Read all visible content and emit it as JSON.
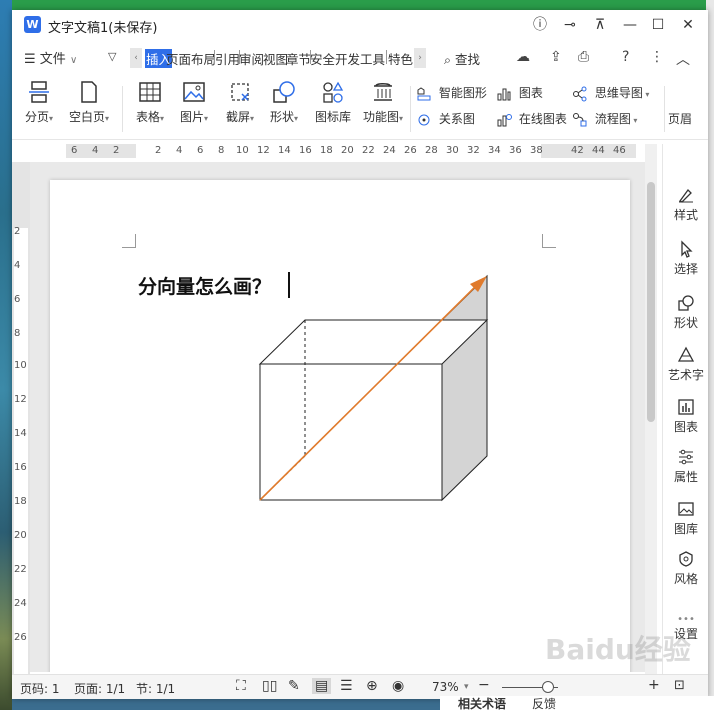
{
  "window": {
    "title": "文字文稿1(未保存)",
    "logo": "W"
  },
  "tabs": {
    "menu_label": "文件",
    "items": [
      "插入",
      "页面布局",
      "引用",
      "审阅",
      "视图",
      "章节",
      "安全",
      "开发工具",
      "特色"
    ],
    "active": "插入",
    "search_label": "查找"
  },
  "toolbar": {
    "large": [
      {
        "label": "分页",
        "icon": "page-break-icon"
      },
      {
        "label": "空白页",
        "icon": "blank-page-icon"
      },
      {
        "label": "表格",
        "icon": "table-icon"
      },
      {
        "label": "图片",
        "icon": "picture-icon"
      },
      {
        "label": "截屏",
        "icon": "screenshot-icon"
      },
      {
        "label": "形状",
        "icon": "shapes-icon"
      },
      {
        "label": "图标库",
        "icon": "icon-library-icon"
      },
      {
        "label": "功能图",
        "icon": "function-chart-icon"
      }
    ],
    "small": [
      {
        "label": "智能图形",
        "icon": "smart-art-icon"
      },
      {
        "label": "图表",
        "icon": "chart-icon"
      },
      {
        "label": "思维导图",
        "icon": "mind-map-icon"
      },
      {
        "label": "关系图",
        "icon": "relation-diagram-icon"
      },
      {
        "label": "在线图表",
        "icon": "online-chart-icon"
      },
      {
        "label": "流程图",
        "icon": "flowchart-icon"
      }
    ],
    "overflow_label": "页眉"
  },
  "ruler": {
    "h_ticks": [
      "6",
      "4",
      "2",
      "2",
      "4",
      "6",
      "8",
      "10",
      "12",
      "14",
      "16",
      "18",
      "20",
      "22",
      "24",
      "26",
      "28",
      "30",
      "32",
      "34",
      "36",
      "38",
      "42",
      "44",
      "46"
    ],
    "v_ticks": [
      "2",
      "4",
      "6",
      "8",
      "10",
      "12",
      "14",
      "16",
      "18",
      "20",
      "22",
      "24",
      "26"
    ]
  },
  "document": {
    "heading": "分向量怎么画？"
  },
  "sidebar": {
    "items": [
      {
        "label": "样式",
        "icon": "style-icon"
      },
      {
        "label": "选择",
        "icon": "select-cursor-icon"
      },
      {
        "label": "形状",
        "icon": "shape-icon"
      },
      {
        "label": "艺术字",
        "icon": "wordart-icon"
      },
      {
        "label": "图表",
        "icon": "chart-icon"
      },
      {
        "label": "属性",
        "icon": "properties-icon"
      },
      {
        "label": "图库",
        "icon": "gallery-icon"
      },
      {
        "label": "风格",
        "icon": "theme-icon"
      },
      {
        "label": "设置",
        "icon": "settings-icon"
      }
    ]
  },
  "statusbar": {
    "page_num": "页码: 1",
    "pages": "页面: 1/1",
    "section": "节: 1/1",
    "zoom": "73%"
  },
  "desktop": {
    "related_label": "相关术语",
    "feedback_label": "反馈"
  },
  "watermark": "Baidu经验"
}
